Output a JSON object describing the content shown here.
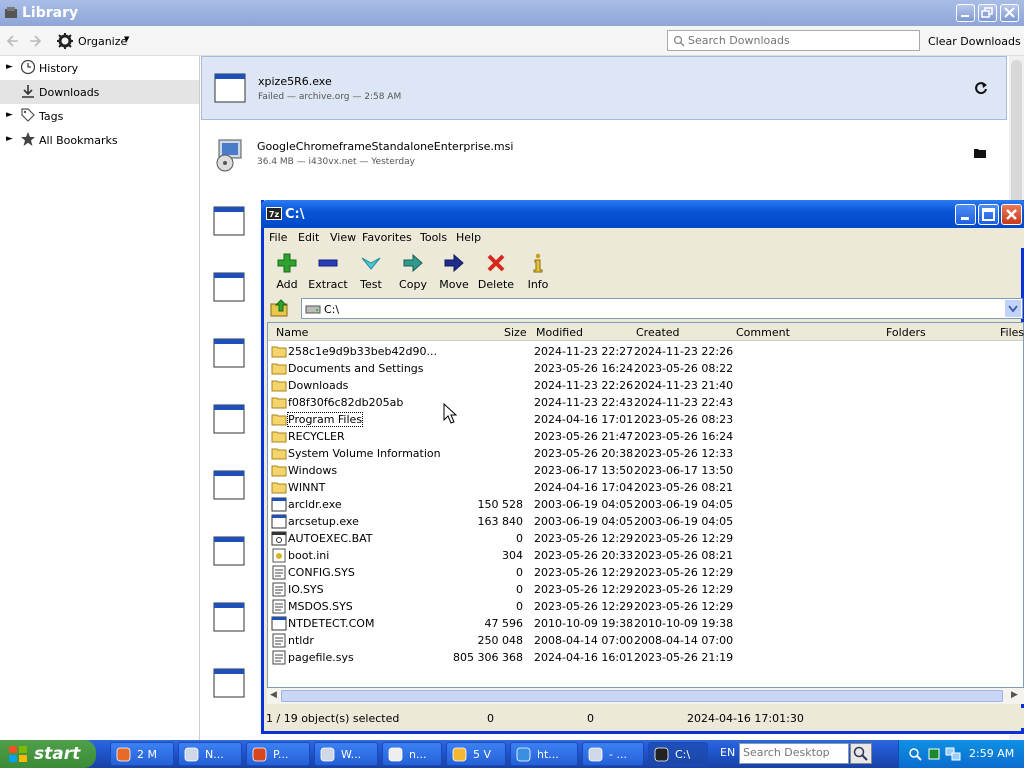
{
  "library": {
    "title": "Library",
    "organize_label": "Organize",
    "search_placeholder": "Search Downloads",
    "clear_label": "Clear Downloads",
    "sidebar": [
      {
        "label": "History",
        "icon": "clock-icon"
      },
      {
        "label": "Downloads",
        "icon": "download-icon"
      },
      {
        "label": "Tags",
        "icon": "tag-icon"
      },
      {
        "label": "All Bookmarks",
        "icon": "star-icon"
      }
    ],
    "downloads": [
      {
        "name": "xpize5R6.exe",
        "status": "Failed — archive.org — 2:58 AM",
        "action": "retry-icon"
      },
      {
        "name": "GoogleChromeframeStandaloneEnterprise.msi",
        "status": "36.4 MB — i430vx.net — Yesterday",
        "action": "folder-icon"
      }
    ]
  },
  "zip": {
    "title": "C:\\",
    "menu": [
      "File",
      "Edit",
      "View",
      "Favorites",
      "Tools",
      "Help"
    ],
    "toolbar": [
      "Add",
      "Extract",
      "Test",
      "Copy",
      "Move",
      "Delete",
      "Info"
    ],
    "address": "C:\\",
    "columns": [
      "Name",
      "Size",
      "Modified",
      "Created",
      "Comment",
      "Folders",
      "Files"
    ],
    "rows": [
      {
        "name": "258c1e9d9b33beb42d90...",
        "size": "",
        "modified": "2024-11-23 22:27",
        "created": "2024-11-23 22:26",
        "type": "folder"
      },
      {
        "name": "Documents and Settings",
        "size": "",
        "modified": "2023-05-26 16:24",
        "created": "2023-05-26 08:22",
        "type": "folder"
      },
      {
        "name": "Downloads",
        "size": "",
        "modified": "2024-11-23 22:26",
        "created": "2024-11-23 21:40",
        "type": "folder"
      },
      {
        "name": "f08f30f6c82db205ab",
        "size": "",
        "modified": "2024-11-23 22:43",
        "created": "2024-11-23 22:43",
        "type": "folder"
      },
      {
        "name": "Program Files",
        "size": "",
        "modified": "2024-04-16 17:01",
        "created": "2023-05-26 08:23",
        "type": "folder"
      },
      {
        "name": "RECYCLER",
        "size": "",
        "modified": "2023-05-26 21:47",
        "created": "2023-05-26 16:24",
        "type": "folder"
      },
      {
        "name": "System Volume Information",
        "size": "",
        "modified": "2023-05-26 20:38",
        "created": "2023-05-26 12:33",
        "type": "folder"
      },
      {
        "name": "Windows",
        "size": "",
        "modified": "2023-06-17 13:50",
        "created": "2023-06-17 13:50",
        "type": "folder"
      },
      {
        "name": "WINNT",
        "size": "",
        "modified": "2024-04-16 17:04",
        "created": "2023-05-26 08:21",
        "type": "folder"
      },
      {
        "name": "arcldr.exe",
        "size": "150 528",
        "modified": "2003-06-19 04:05",
        "created": "2003-06-19 04:05",
        "type": "exe"
      },
      {
        "name": "arcsetup.exe",
        "size": "163 840",
        "modified": "2003-06-19 04:05",
        "created": "2003-06-19 04:05",
        "type": "exe"
      },
      {
        "name": "AUTOEXEC.BAT",
        "size": "0",
        "modified": "2023-05-26 12:29",
        "created": "2023-05-26 12:29",
        "type": "bat"
      },
      {
        "name": "boot.ini",
        "size": "304",
        "modified": "2023-05-26 20:33",
        "created": "2023-05-26 08:21",
        "type": "ini"
      },
      {
        "name": "CONFIG.SYS",
        "size": "0",
        "modified": "2023-05-26 12:29",
        "created": "2023-05-26 12:29",
        "type": "sys"
      },
      {
        "name": "IO.SYS",
        "size": "0",
        "modified": "2023-05-26 12:29",
        "created": "2023-05-26 12:29",
        "type": "sys"
      },
      {
        "name": "MSDOS.SYS",
        "size": "0",
        "modified": "2023-05-26 12:29",
        "created": "2023-05-26 12:29",
        "type": "sys"
      },
      {
        "name": "NTDETECT.COM",
        "size": "47 596",
        "modified": "2010-10-09 19:38",
        "created": "2010-10-09 19:38",
        "type": "exe"
      },
      {
        "name": "ntldr",
        "size": "250 048",
        "modified": "2008-04-14 07:00",
        "created": "2008-04-14 07:00",
        "type": "sys"
      },
      {
        "name": "pagefile.sys",
        "size": "805 306 368",
        "modified": "2024-04-16 16:01",
        "created": "2023-05-26 21:19",
        "type": "sys"
      }
    ],
    "status": {
      "selected": "1 / 19 object(s) selected",
      "size": "0",
      "packed": "0",
      "date": "2024-04-16 17:01:30"
    }
  },
  "taskbar": {
    "start": "start",
    "tasks": [
      {
        "label": "2 M",
        "icon": "firefox-icon"
      },
      {
        "label": "N...",
        "icon": "network-icon"
      },
      {
        "label": "P...",
        "icon": "record-icon"
      },
      {
        "label": "W...",
        "icon": "computer-icon"
      },
      {
        "label": "n...",
        "icon": "notepad-icon"
      },
      {
        "label": "5 V",
        "icon": "apps-icon"
      },
      {
        "label": "ht...",
        "icon": "ie-icon"
      },
      {
        "label": "- ...",
        "icon": "search-icon"
      },
      {
        "label": "C:\\",
        "icon": "7zip-icon"
      }
    ],
    "lang": "EN",
    "search_placeholder": "Search Desktop",
    "clock": "2:59 AM"
  }
}
